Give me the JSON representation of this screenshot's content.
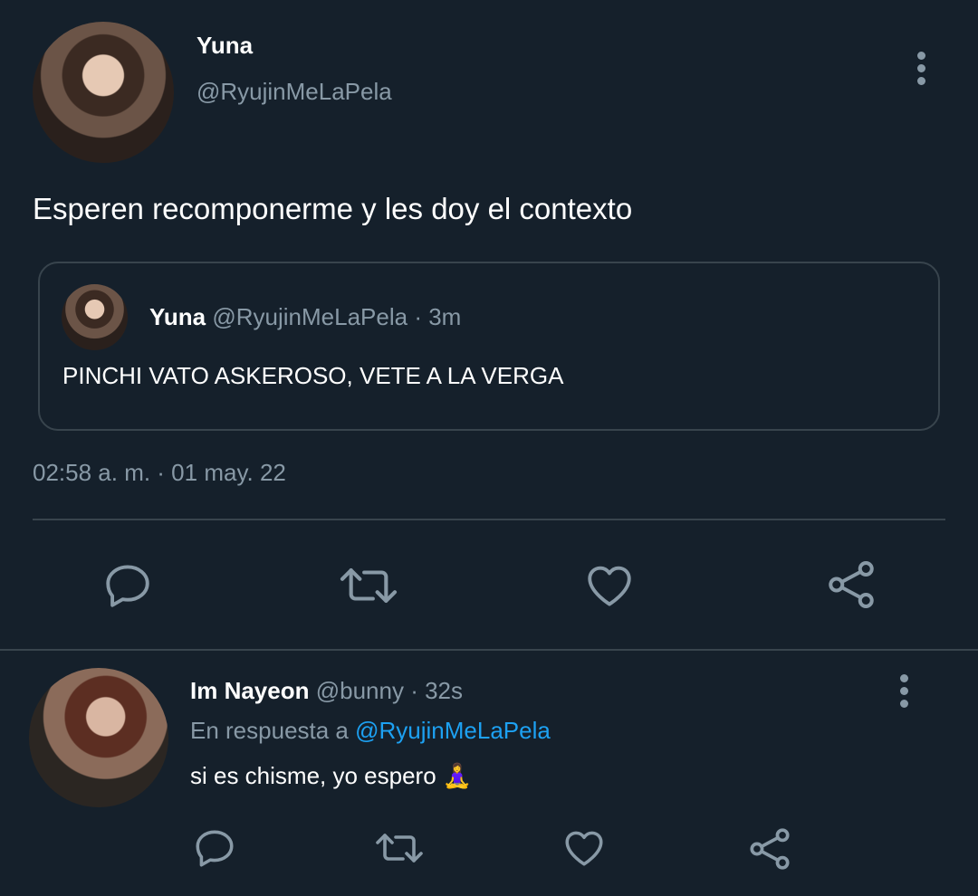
{
  "tweet": {
    "author_name": "Yuna",
    "author_handle": "@RyujinMeLaPela",
    "text": "Esperen recomponerme y les doy el contexto",
    "timestamp": "02:58 a. m. · 01 may. 22",
    "quoted": {
      "author_name": "Yuna",
      "meta": "@RyujinMeLaPela · 3m",
      "text": "PINCHI VATO ASKEROSO, VETE A LA VERGA"
    }
  },
  "reply": {
    "author_name": "Im Nayeon",
    "meta": "@bunny · 32s",
    "in_reply_prefix": "En respuesta a",
    "in_reply_handle": "@RyujinMeLaPela",
    "text": "si es chisme, yo espero 🧘‍♀️"
  },
  "icons": {
    "reply": "speech-bubble-icon",
    "retweet": "retweet-icon",
    "like": "heart-icon",
    "share": "share-icon",
    "more": "more-vertical-icon"
  },
  "colors": {
    "background": "#15202b",
    "muted": "#8899a6",
    "link": "#1da1f2",
    "border": "#38444d"
  }
}
